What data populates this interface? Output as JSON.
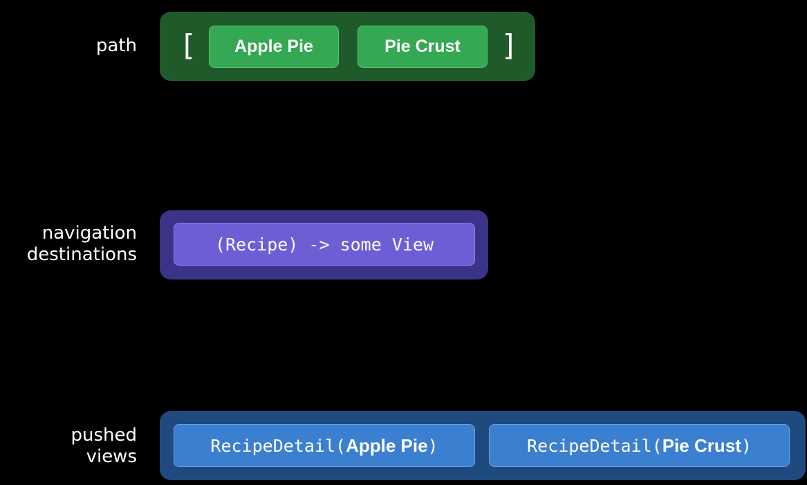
{
  "rows": {
    "path": {
      "label_lines": [
        "path"
      ],
      "open_bracket": "[",
      "close_bracket": "]",
      "items": [
        "Apple Pie",
        "Pie Crust"
      ]
    },
    "destinations": {
      "label_lines": [
        "navigation",
        "destinations"
      ],
      "items": [
        "(Recipe) -> some View"
      ]
    },
    "views": {
      "label_lines": [
        "pushed",
        "views"
      ],
      "items": [
        {
          "prefix": "RecipeDetail(",
          "arg": "Apple Pie",
          "suffix": ")"
        },
        {
          "prefix": "RecipeDetail(",
          "arg": "Pie Crust",
          "suffix": ")"
        }
      ]
    }
  },
  "colors": {
    "background": "#000000",
    "path_panel": "#1f5a2a",
    "path_chip": "#34a853",
    "destinations_panel": "#3a3387",
    "destinations_chip": "#6c5fd6",
    "views_panel": "#1f4a80",
    "views_chip": "#3b7fd0"
  }
}
